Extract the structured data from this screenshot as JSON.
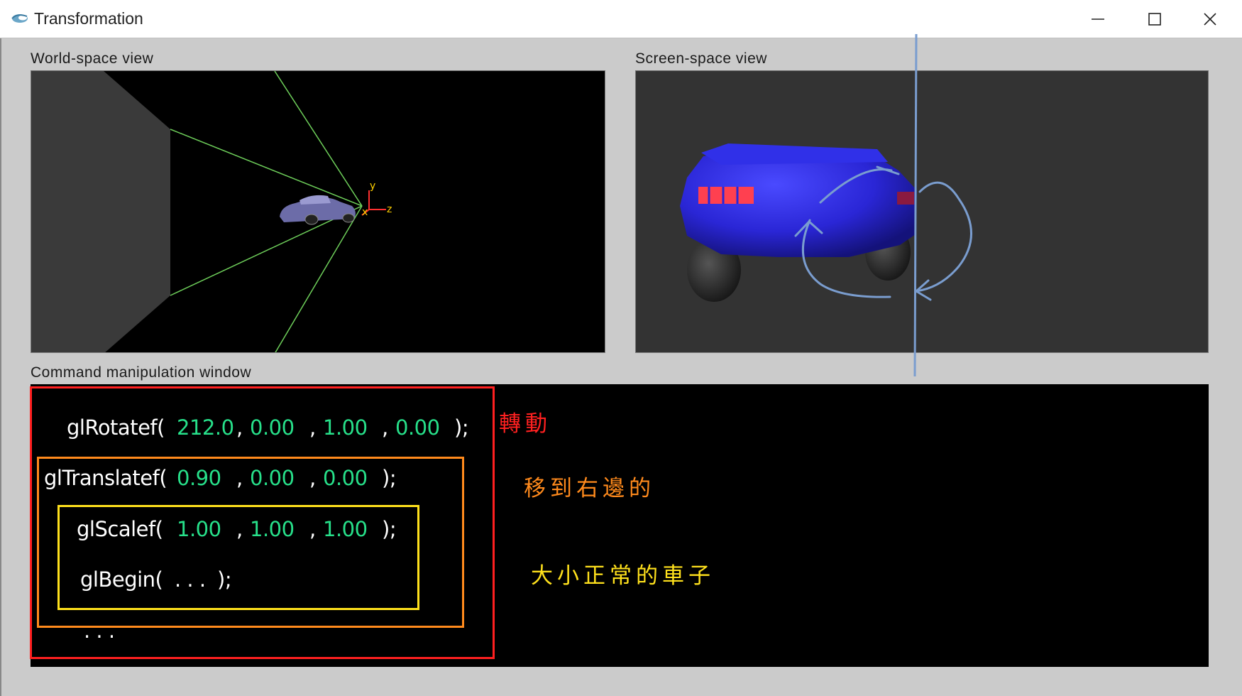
{
  "window": {
    "title": "Transformation",
    "icon": "window-app-icon",
    "controls": [
      "minimize-icon",
      "maximize-icon",
      "close-icon"
    ]
  },
  "world_view": {
    "label": "World-space view",
    "axis_labels": {
      "y": "y",
      "z": "z",
      "x": "x"
    }
  },
  "screen_view": {
    "label": "Screen-space view"
  },
  "command_window": {
    "label": "Command manipulation window",
    "rotate": {
      "fn": "glRotatef(",
      "angle": "212.0",
      "x": "0.00",
      "y": "1.00",
      "z": "0.00",
      "close": ");"
    },
    "translate": {
      "fn": "glTranslatef(",
      "x": "0.90",
      "y": "0.00",
      "z": "0.00",
      "close": ");"
    },
    "scale": {
      "fn": "glScalef(",
      "x": "1.00",
      "y": "1.00",
      "z": "1.00",
      "close": ");"
    },
    "begin": {
      "fn": "glBegin(",
      "args": ". . .",
      "close": ");"
    },
    "ellipsis": ". . ."
  },
  "annotations": {
    "rotate_note": "轉動",
    "translate_note": "移到右邊的",
    "scale_note": "大小正常的車子"
  },
  "colors": {
    "numbers": "#27e08a",
    "rotate_box": "#ff2020",
    "translate_box": "#ff8a1c",
    "scale_box": "#ffe11c",
    "world_bg": "#000000",
    "screen_bg": "#333333",
    "car": "#2b27d8"
  }
}
